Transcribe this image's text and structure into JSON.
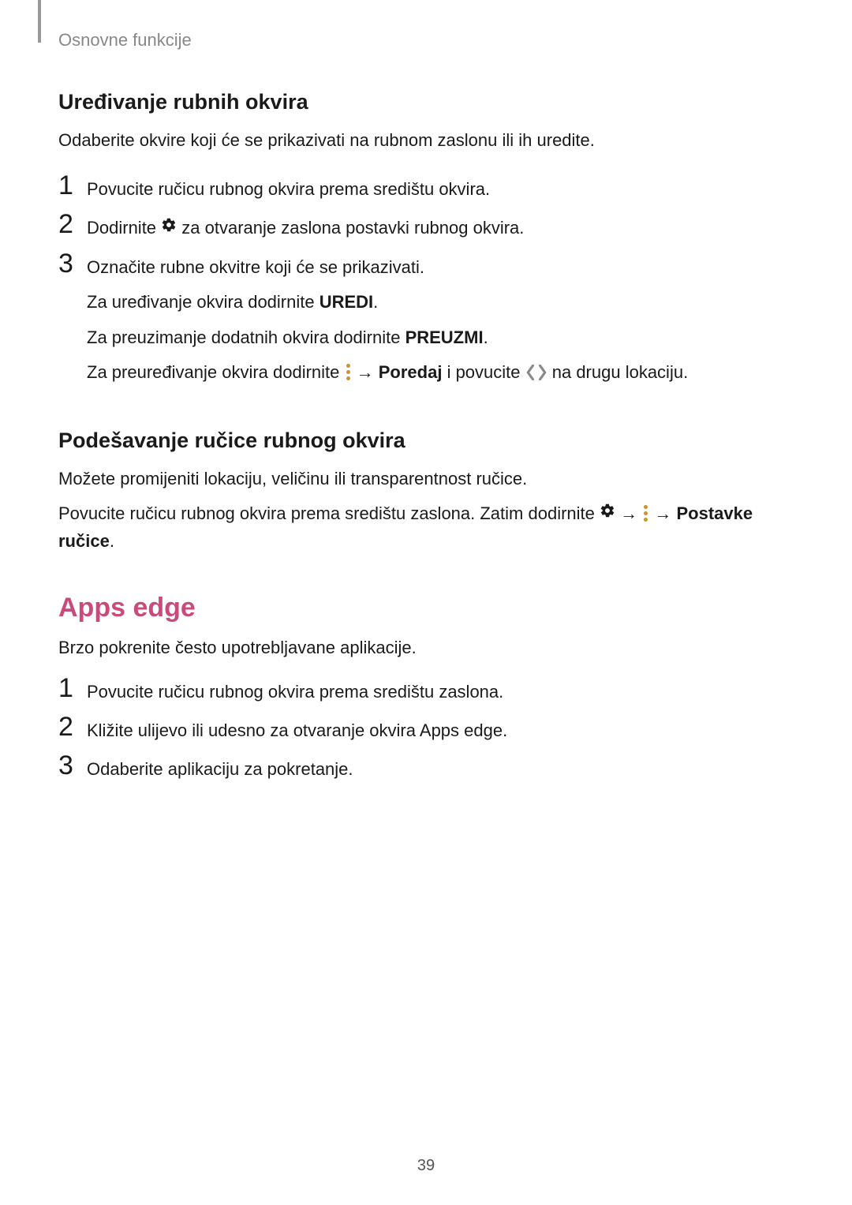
{
  "header": {
    "breadcrumb": "Osnovne funkcije"
  },
  "s1": {
    "title": "Uređivanje rubnih okvira",
    "intro": "Odaberite okvire koji će se prikazivati na rubnom zaslonu ili ih uredite.",
    "step1_num": "1",
    "step1_text": "Povucite ručicu rubnog okvira prema središtu okvira.",
    "step2_num": "2",
    "step2_pre": "Dodirnite ",
    "step2_post": " za otvaranje zaslona postavki rubnog okvira.",
    "step3_num": "3",
    "step3_l1": "Označite rubne okvitre koji će se prikazivati.",
    "step3_l2_pre": "Za uređivanje okvira dodirnite ",
    "step3_l2_bold": "UREDI",
    "step3_l2_post": ".",
    "step3_l3_pre": "Za preuzimanje dodatnih okvira dodirnite ",
    "step3_l3_bold": "PREUZMI",
    "step3_l3_post": ".",
    "step3_l4_pre": "Za preuređivanje okvira dodirnite ",
    "step3_l4_arrow": " → ",
    "step3_l4_bold": "Poredaj",
    "step3_l4_mid": " i povucite ",
    "step3_l4_post": " na drugu lokaciju."
  },
  "s2": {
    "title": "Podešavanje ručice rubnog okvira",
    "p1": "Možete promijeniti lokaciju, veličinu ili transparentnost ručice.",
    "p2_pre": "Povucite ručicu rubnog okvira prema središtu zaslona. Zatim dodirnite ",
    "p2_arrow1": " → ",
    "p2_arrow2": " → ",
    "p2_bold": "Postavke ručice",
    "p2_post": "."
  },
  "s3": {
    "title": "Apps edge",
    "intro": "Brzo pokrenite često upotrebljavane aplikacije.",
    "step1_num": "1",
    "step1_text": "Povucite ručicu rubnog okvira prema središtu zaslona.",
    "step2_num": "2",
    "step2_text": "Kližite ulijevo ili udesno za otvaranje okvira Apps edge.",
    "step3_num": "3",
    "step3_text": "Odaberite aplikaciju za pokretanje."
  },
  "footer": {
    "page_num": "39"
  }
}
